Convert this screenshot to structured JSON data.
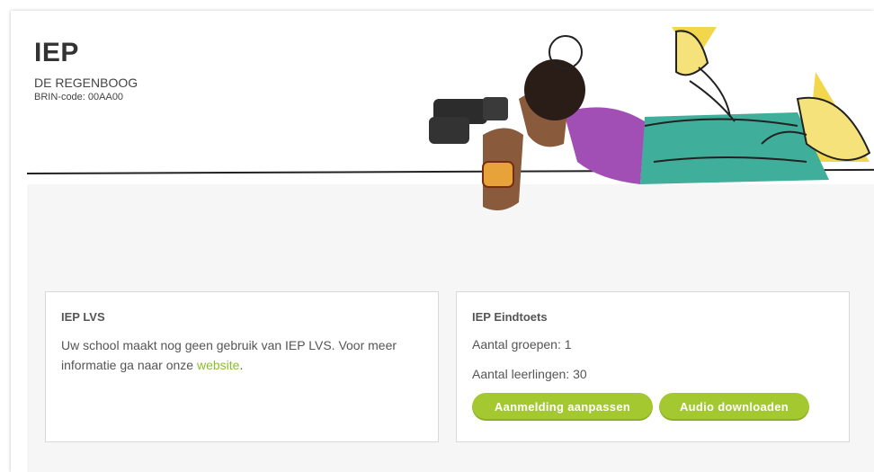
{
  "header": {
    "title": "IEP",
    "school_name": "DE REGENBOOG",
    "brin": "BRIN-code: 00AA00"
  },
  "cards": {
    "lvs": {
      "title": "IEP LVS",
      "text_before_link": "Uw school maakt nog geen gebruik van IEP LVS. Voor meer informatie ga naar onze ",
      "link_label": "website",
      "text_after_link": "."
    },
    "eindtoets": {
      "title": "IEP Eindtoets",
      "groups": "Aantal groepen: 1",
      "students": "Aantal leerlingen: 30",
      "button_register": "Aanmelding aanpassen",
      "button_audio": "Audio downloaden"
    }
  },
  "colors": {
    "accent": "#a4c82f",
    "link": "#8cbd2a",
    "teal": "#3fae9a",
    "yellow": "#f2d64b",
    "purple": "#a24fb5"
  },
  "illustration": {
    "icon": "girl-with-binoculars-illustration"
  }
}
